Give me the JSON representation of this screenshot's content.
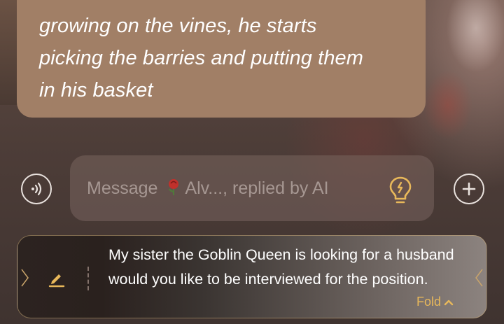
{
  "chat": {
    "bubble": {
      "lines": [
        "growing on the vines, he starts",
        "picking the barries and putting them",
        "in his basket"
      ]
    }
  },
  "composer": {
    "placeholder_prefix": "Message",
    "placeholder_name": "Alv..., replied by AI",
    "icons": {
      "voice": "voice-icon",
      "rose": "rose-icon",
      "hint": "lightbulb-icon",
      "add": "plus-icon"
    }
  },
  "suggestion": {
    "text": "My sister the Goblin Queen is looking for a husband would you like to be interviewed for the position.",
    "fold_label": "Fold",
    "icons": {
      "edit": "pencil-icon",
      "fold": "chevron-up-icon"
    }
  },
  "colors": {
    "bubble": "#a17f66",
    "accent": "#e8b85a",
    "icon_outline": "#e9e2de"
  }
}
